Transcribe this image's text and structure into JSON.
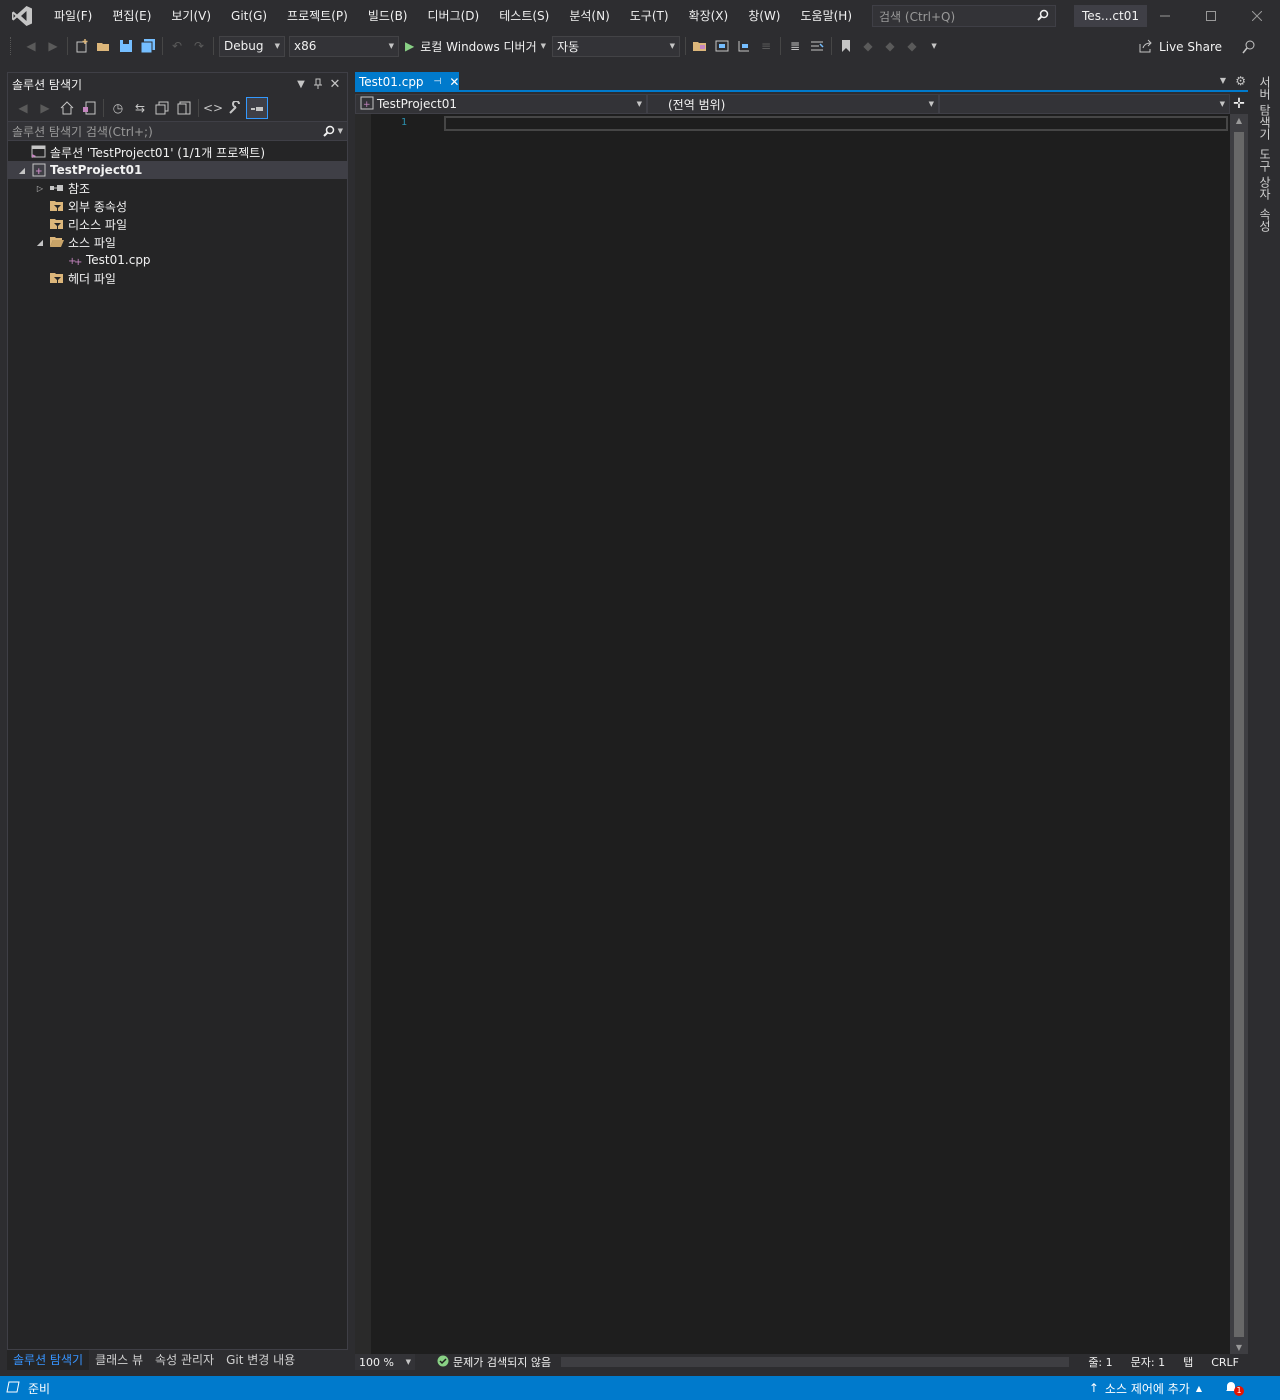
{
  "menu": {
    "items": [
      "파일(F)",
      "편집(E)",
      "보기(V)",
      "Git(G)",
      "프로젝트(P)",
      "빌드(B)",
      "디버그(D)",
      "테스트(S)",
      "분석(N)",
      "도구(T)",
      "확장(X)",
      "창(W)",
      "도움말(H)"
    ],
    "search_placeholder": "검색 (Ctrl+Q)",
    "solution_title": "Tes...ct01"
  },
  "toolbar": {
    "config": "Debug",
    "platform": "x86",
    "run_label": "로컬 Windows 디버거",
    "run_mode": "자동",
    "live_share": "Live Share"
  },
  "solution_explorer": {
    "title": "솔루션 탐색기",
    "search_placeholder": "솔루션 탐색기 검색(Ctrl+;)",
    "tree": [
      {
        "label": "솔루션 'TestProject01' (1/1개 프로젝트)",
        "depth": 0,
        "icon": "solution-icon",
        "expander": ""
      },
      {
        "label": "TestProject01",
        "depth": 0,
        "icon": "cpp-project-icon",
        "expander": "expanded",
        "selected": true
      },
      {
        "label": "참조",
        "depth": 1,
        "icon": "references-icon",
        "expander": "collapsed"
      },
      {
        "label": "외부 종속성",
        "depth": 1,
        "icon": "filter-folder-icon",
        "expander": ""
      },
      {
        "label": "리소스 파일",
        "depth": 1,
        "icon": "filter-folder-icon",
        "expander": ""
      },
      {
        "label": "소스 파일",
        "depth": 1,
        "icon": "filter-folder-open-icon",
        "expander": "expanded"
      },
      {
        "label": "Test01.cpp",
        "depth": 2,
        "icon": "cpp-file-icon",
        "expander": ""
      },
      {
        "label": "헤더 파일",
        "depth": 1,
        "icon": "filter-folder-icon",
        "expander": ""
      }
    ],
    "bottom_tabs": [
      "솔루션 탐색기",
      "클래스 뷰",
      "속성 관리자",
      "Git 변경 내용"
    ]
  },
  "editor": {
    "tab_name": "Test01.cpp",
    "nav_project": "TestProject01",
    "nav_scope": "(전역 범위)",
    "nav_member": "",
    "line_numbers": [
      "1"
    ],
    "zoom": "100 %",
    "issues": "문제가 검색되지 않음",
    "line": "줄: 1",
    "char": "문자: 1",
    "indent": "탭",
    "line_ending": "CRLF"
  },
  "right_dock": {
    "tabs": [
      "서버 탐색기",
      "도구 상자",
      "속성"
    ]
  },
  "statusbar": {
    "ready": "준비",
    "source_control": "소스 제어에 추가",
    "notification_count": "1"
  },
  "colors": {
    "accent": "#007acc",
    "background": "#2d2d30",
    "editor_bg": "#1e1e1e",
    "line_number": "#2b91af"
  }
}
